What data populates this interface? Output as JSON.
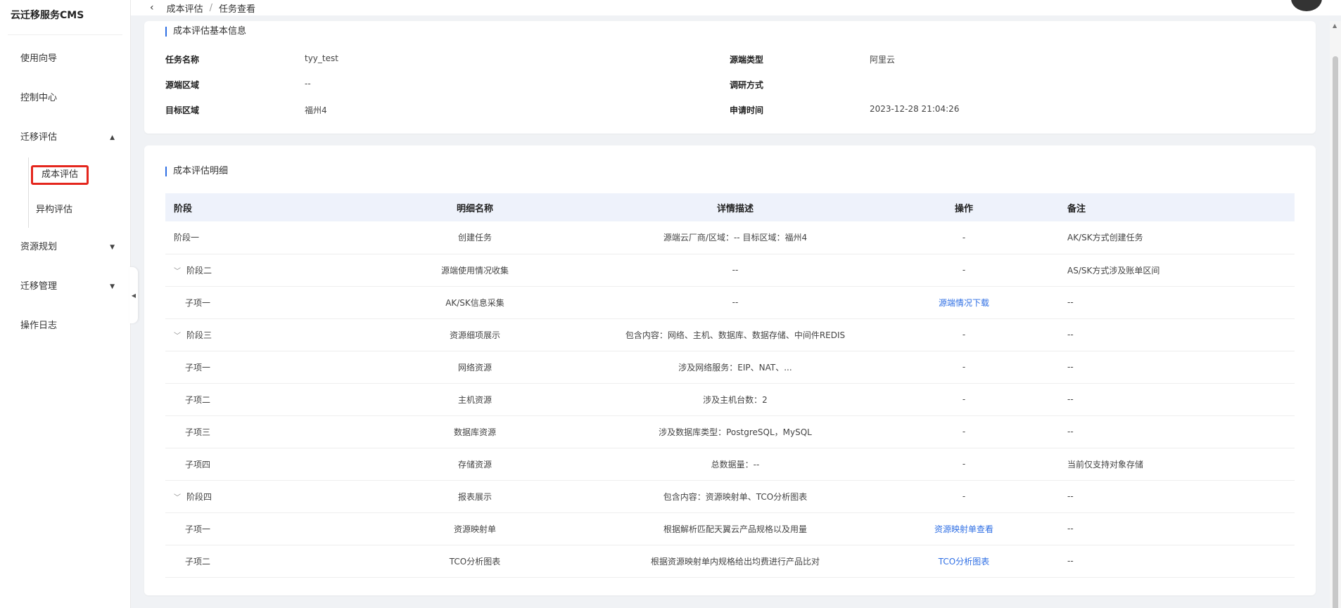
{
  "sidebar": {
    "brand": "云迁移服务CMS",
    "items": [
      {
        "label": "使用向导"
      },
      {
        "label": "控制中心"
      },
      {
        "label": "迁移评估",
        "caret": "▲"
      },
      {
        "label": "资源规划",
        "caret": "▼"
      },
      {
        "label": "迁移管理",
        "caret": "▼"
      },
      {
        "label": "操作日志"
      }
    ],
    "sub_items": [
      {
        "label": "成本评估",
        "active": true
      },
      {
        "label": "异构评估"
      }
    ],
    "collapse_icon": "◀"
  },
  "header": {
    "back_icon": "‹",
    "breadcrumb": [
      "成本评估",
      "任务查看"
    ],
    "separator": "/"
  },
  "basic_info": {
    "title": "成本评估基本信息",
    "fields": [
      {
        "label": "任务名称",
        "value": "tyy_test"
      },
      {
        "label": "源端类型",
        "value": "阿里云"
      },
      {
        "label": "源端区域",
        "value": "--"
      },
      {
        "label": "调研方式",
        "value": ""
      },
      {
        "label": "目标区域",
        "value": "福州4"
      },
      {
        "label": "申请时间",
        "value": "2023-12-28 21:04:26"
      }
    ]
  },
  "detail": {
    "title": "成本评估明细",
    "columns": [
      "阶段",
      "明细名称",
      "详情描述",
      "操作",
      "备注"
    ],
    "rows": [
      {
        "stage": "阶段一",
        "name": "创建任务",
        "desc": "源端云厂商/区域：--    目标区域：福州4",
        "op": "-",
        "remark": "AK/SK方式创建任务",
        "expand": "",
        "sub": false,
        "link": false
      },
      {
        "stage": "阶段二",
        "name": "源端使用情况收集",
        "desc": "--",
        "op": "-",
        "remark": "AS/SK方式涉及账单区间",
        "expand": "﹀",
        "sub": false,
        "link": false
      },
      {
        "stage": "子项一",
        "name": "AK/SK信息采集",
        "desc": "--",
        "op": "源端情况下载",
        "remark": "--",
        "expand": "",
        "sub": true,
        "link": true
      },
      {
        "stage": "阶段三",
        "name": "资源细项展示",
        "desc": "包含内容：网络、主机、数据库、数据存储、中间件REDIS",
        "op": "-",
        "remark": "--",
        "expand": "﹀",
        "sub": false,
        "link": false
      },
      {
        "stage": "子项一",
        "name": "网络资源",
        "desc": "涉及网络服务：EIP、NAT、...",
        "op": "-",
        "remark": "--",
        "expand": "",
        "sub": true,
        "link": false
      },
      {
        "stage": "子项二",
        "name": "主机资源",
        "desc": "涉及主机台数：2",
        "op": "-",
        "remark": "--",
        "expand": "",
        "sub": true,
        "link": false
      },
      {
        "stage": "子项三",
        "name": "数据库资源",
        "desc": "涉及数据库类型：PostgreSQL，MySQL",
        "op": "-",
        "remark": "--",
        "expand": "",
        "sub": true,
        "link": false
      },
      {
        "stage": "子项四",
        "name": "存储资源",
        "desc": "总数据量：--",
        "op": "-",
        "remark": "当前仅支持对象存储",
        "expand": "",
        "sub": true,
        "link": false
      },
      {
        "stage": "阶段四",
        "name": "报表展示",
        "desc": "包含内容：资源映射单、TCO分析图表",
        "op": "-",
        "remark": "--",
        "expand": "﹀",
        "sub": false,
        "link": false
      },
      {
        "stage": "子项一",
        "name": "资源映射单",
        "desc": "根据解析匹配天翼云产品规格以及用量",
        "op": "资源映射单查看",
        "remark": "--",
        "expand": "",
        "sub": true,
        "link": true
      },
      {
        "stage": "子项二",
        "name": "TCO分析图表",
        "desc": "根据资源映射单内规格给出均费进行产品比对",
        "op": "TCO分析图表",
        "remark": "--",
        "expand": "",
        "sub": true,
        "link": true
      }
    ]
  },
  "colors": {
    "accent": "#2f6fe4",
    "highlight": "#e4261d"
  }
}
